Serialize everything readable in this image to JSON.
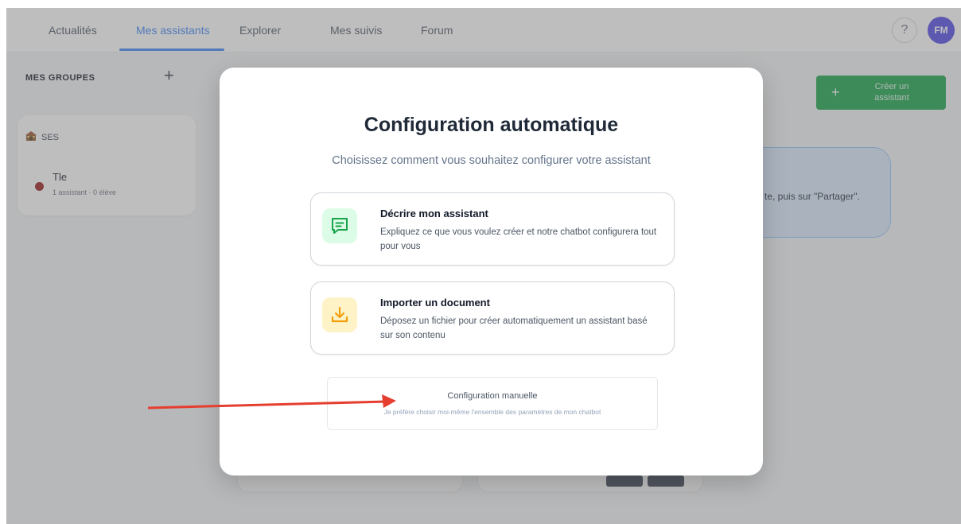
{
  "nav": {
    "tabs": [
      {
        "label": "Actualités"
      },
      {
        "label": "Mes assistants"
      },
      {
        "label": "Explorer"
      },
      {
        "label": "Mes suivis"
      },
      {
        "label": "Forum"
      }
    ],
    "active_tab": "Mes assistants",
    "help_label": "?",
    "avatar_initials": "FM"
  },
  "sidebar": {
    "title": "MES GROUPES",
    "add_label": "+",
    "group": {
      "icon": "school-icon",
      "name": "SES",
      "class_name": "Tle",
      "class_meta": "1 assistant · 0 élève"
    }
  },
  "main": {
    "create_button": {
      "plus": "+",
      "label": "Créer un assistant"
    },
    "info_text": "te, puis sur \"Partager\"."
  },
  "modal": {
    "title": "Configuration automatique",
    "subtitle": "Choisissez comment vous souhaitez configurer votre assistant",
    "options": [
      {
        "icon": "chat-bubble-icon",
        "title": "Décrire mon assistant",
        "description": "Expliquez ce que vous voulez créer et notre chatbot configurera tout pour vous"
      },
      {
        "icon": "download-icon",
        "title": "Importer un document",
        "description": "Déposez un fichier pour créer automatiquement un assistant basé sur son contenu"
      }
    ],
    "manual": {
      "title": "Configuration manuelle",
      "description": "Je préfère choisir moi-même l'ensemble des paramètres de mon chatbot"
    }
  },
  "colors": {
    "accent": "#3b82f6",
    "create_button": "#16a34a",
    "avatar": "#4f46e5",
    "annotation_arrow": "#e53e2f"
  }
}
